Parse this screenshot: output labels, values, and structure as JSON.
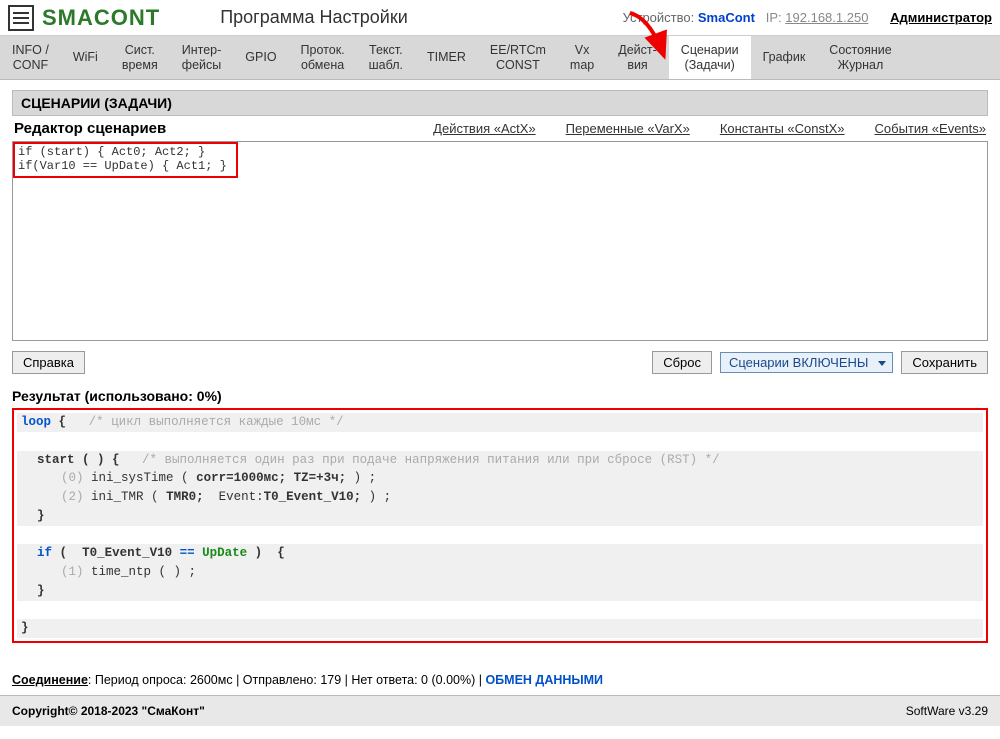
{
  "header": {
    "logo": "SMACONT",
    "title": "Программа Настройки",
    "device_label": "Устройство:",
    "device_name": "SmaCont",
    "ip_label": "IP:",
    "ip": "192.168.1.250",
    "admin": "Администратор"
  },
  "tabs": [
    {
      "l1": "INFO /",
      "l2": "CONF"
    },
    {
      "l1": "WiFi",
      "l2": ""
    },
    {
      "l1": "Сист.",
      "l2": "время"
    },
    {
      "l1": "Интер-",
      "l2": "фейсы"
    },
    {
      "l1": "GPIO",
      "l2": ""
    },
    {
      "l1": "Проток.",
      "l2": "обмена"
    },
    {
      "l1": "Текст.",
      "l2": "шабл."
    },
    {
      "l1": "TIMER",
      "l2": ""
    },
    {
      "l1": "EE/RTCm",
      "l2": "CONST"
    },
    {
      "l1": "Vx",
      "l2": "map"
    },
    {
      "l1": "Дейст-",
      "l2": "вия"
    },
    {
      "l1": "Сценарии",
      "l2": "(Задачи)"
    },
    {
      "l1": "График",
      "l2": ""
    },
    {
      "l1": "Состояние",
      "l2": "Журнал"
    }
  ],
  "active_tab_index": 11,
  "section_title": "СЦЕНАРИИ (ЗАДАЧИ)",
  "editor": {
    "label": "Редактор сценариев",
    "links": [
      "Действия «ActX»",
      "Переменные «VarX»",
      "Константы «ConstX»",
      "События «Events»"
    ],
    "text": "if (start) { Act0; Act2; }\nif(Var10 == UpDate) { Act1; }"
  },
  "buttons": {
    "help": "Справка",
    "reset": "Сброс",
    "select": "Сценарии ВКЛЮЧЕНЫ",
    "save": "Сохранить"
  },
  "result": {
    "label": "Результат (использовано: 0%)",
    "c_loop": "loop",
    "c_loop_comment": "/* цикл выполняется каждые 10мс */",
    "c_start": "start",
    "c_start_comment": "/* выполняется один раз при подаче напряжения питания или при сбросе (RST) */",
    "c_line0_num": "(0)",
    "c_line0": "ini_sysTime",
    "c_line0_args": "corr=1000мс; TZ=+3ч;",
    "c_line2_num": "(2)",
    "c_line2": "ini_TMR",
    "c_line2_args_a": "TMR0;",
    "c_line2_args_b": "Event:",
    "c_line2_args_c": "T0_Event_V10;",
    "c_if": "if",
    "c_if_var": "T0_Event_V10",
    "c_if_eq": "==",
    "c_if_val": "UpDate",
    "c_line1_num": "(1)",
    "c_line1": "time_ntp"
  },
  "footer": {
    "conn_label": "Соединение",
    "conn_text": ": Период опроса: 2600мс | Отправлено: 179 | Нет ответа: 0 (0.00%) | ",
    "conn_ex": "ОБМЕН ДАННЫМИ",
    "copyright": "Copyright© 2018-2023 \"СмаКонт\"",
    "version": "SoftWare v3.29"
  }
}
